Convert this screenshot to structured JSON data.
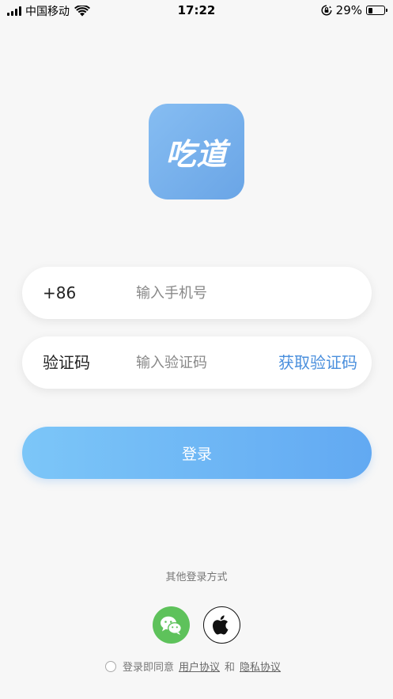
{
  "status_bar": {
    "carrier": "中国移动",
    "time": "17:22",
    "battery_percent": "29%",
    "battery_level": 0.29,
    "icons": [
      "signal-icon",
      "wifi-icon",
      "orientation-lock-icon",
      "battery-icon"
    ]
  },
  "logo": {
    "text": "吃道"
  },
  "phone_field": {
    "prefix": "+86",
    "placeholder": "输入手机号",
    "value": ""
  },
  "code_field": {
    "label": "验证码",
    "placeholder": "输入验证码",
    "value": "",
    "action_label": "获取验证码"
  },
  "login_button": {
    "label": "登录"
  },
  "other_login": {
    "label": "其他登录方式",
    "options": [
      {
        "icon": "wechat-icon"
      },
      {
        "icon": "apple-icon"
      }
    ]
  },
  "agreement": {
    "text": "登录即同意",
    "user_agreement": "用户协议",
    "and": "和",
    "privacy_policy": "隐私协议",
    "checked": false
  },
  "colors": {
    "accent": "#4a8fdd",
    "button_gradient_start": "#7cc6f8",
    "button_gradient_end": "#62a9f2",
    "logo_bg": "#78b0ec",
    "wechat_green": "#5ec25b",
    "background": "#f7f7f7"
  }
}
